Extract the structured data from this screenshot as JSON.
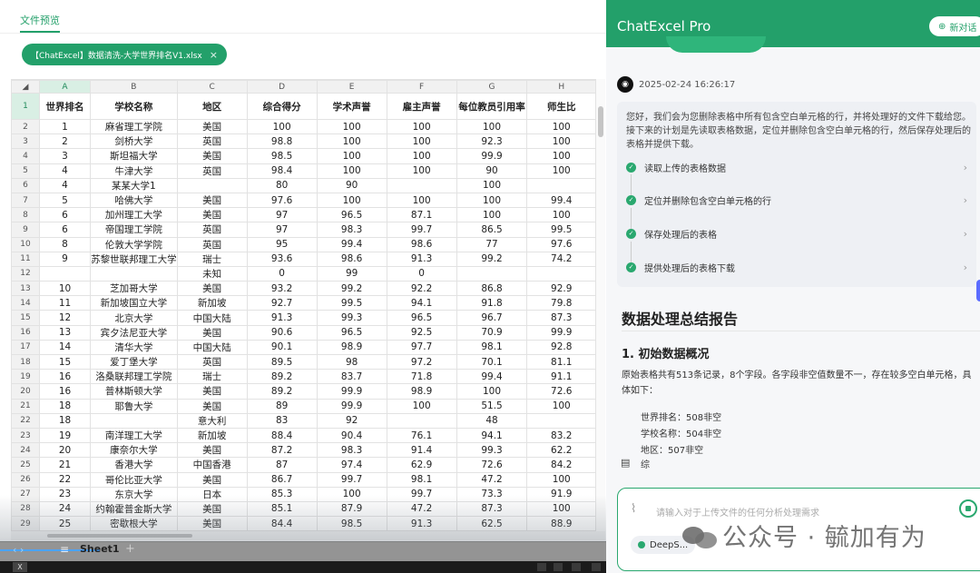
{
  "preview": {
    "tab_label": "文件预览",
    "file_pill": "【ChatExcel】数据清洗-大学世界排名V1.xlsx",
    "file_close": "×"
  },
  "spreadsheet": {
    "column_letters": [
      "A",
      "B",
      "C",
      "D",
      "E",
      "F",
      "G",
      "H"
    ],
    "headers": [
      "世界排名",
      "学校名称",
      "地区",
      "综合得分",
      "学术声誉",
      "雇主声誉",
      "每位教员引用率",
      "师生比"
    ],
    "rows": [
      [
        "2",
        "1",
        "麻省理工学院",
        "美国",
        "100",
        "100",
        "100",
        "100",
        "100"
      ],
      [
        "3",
        "2",
        "剑桥大学",
        "英国",
        "98.8",
        "100",
        "100",
        "92.3",
        "100"
      ],
      [
        "4",
        "3",
        "斯坦福大学",
        "美国",
        "98.5",
        "100",
        "100",
        "99.9",
        "100"
      ],
      [
        "5",
        "4",
        "牛津大学",
        "英国",
        "98.4",
        "100",
        "100",
        "90",
        "100"
      ],
      [
        "6",
        "4",
        "某某大学1",
        "",
        "80",
        "90",
        "",
        "100",
        ""
      ],
      [
        "7",
        "5",
        "哈佛大学",
        "美国",
        "97.6",
        "100",
        "100",
        "100",
        "99.4"
      ],
      [
        "8",
        "6",
        "加州理工大学",
        "美国",
        "97",
        "96.5",
        "87.1",
        "100",
        "100"
      ],
      [
        "9",
        "6",
        "帝国理工学院",
        "英国",
        "97",
        "98.3",
        "99.7",
        "86.5",
        "99.5"
      ],
      [
        "10",
        "8",
        "伦敦大学学院",
        "英国",
        "95",
        "99.4",
        "98.6",
        "77",
        "97.6"
      ],
      [
        "11",
        "9",
        "苏黎世联邦理工大学",
        "瑞士",
        "93.6",
        "98.6",
        "91.3",
        "99.2",
        "74.2"
      ],
      [
        "12",
        "",
        "",
        "未知",
        "0",
        "99",
        "0",
        "",
        ""
      ],
      [
        "13",
        "10",
        "芝加哥大学",
        "美国",
        "93.2",
        "99.2",
        "92.2",
        "86.8",
        "92.9"
      ],
      [
        "14",
        "11",
        "新加坡国立大学",
        "新加坡",
        "92.7",
        "99.5",
        "94.1",
        "91.8",
        "79.8"
      ],
      [
        "15",
        "12",
        "北京大学",
        "中国大陆",
        "91.3",
        "99.3",
        "96.5",
        "96.7",
        "87.3"
      ],
      [
        "16",
        "13",
        "宾夕法尼亚大学",
        "美国",
        "90.6",
        "96.5",
        "92.5",
        "70.9",
        "99.9"
      ],
      [
        "17",
        "14",
        "清华大学",
        "中国大陆",
        "90.1",
        "98.9",
        "97.7",
        "98.1",
        "92.8"
      ],
      [
        "18",
        "15",
        "爱丁堡大学",
        "英国",
        "89.5",
        "98",
        "97.2",
        "70.1",
        "81.1"
      ],
      [
        "19",
        "16",
        "洛桑联邦理工学院",
        "瑞士",
        "89.2",
        "83.7",
        "71.8",
        "99.4",
        "91.1"
      ],
      [
        "20",
        "16",
        "普林斯顿大学",
        "美国",
        "89.2",
        "99.9",
        "98.9",
        "100",
        "72.6"
      ],
      [
        "21",
        "18",
        "耶鲁大学",
        "美国",
        "89",
        "99.9",
        "100",
        "51.5",
        "100"
      ],
      [
        "22",
        "18",
        "",
        "意大利",
        "83",
        "92",
        "",
        "48",
        ""
      ],
      [
        "23",
        "19",
        "南洋理工大学",
        "新加坡",
        "88.4",
        "90.4",
        "76.1",
        "94.1",
        "83.2"
      ],
      [
        "24",
        "20",
        "康奈尔大学",
        "美国",
        "87.2",
        "98.3",
        "91.4",
        "99.3",
        "62.2"
      ],
      [
        "25",
        "21",
        "香港大学",
        "中国香港",
        "87",
        "97.4",
        "62.9",
        "72.6",
        "84.2"
      ],
      [
        "26",
        "22",
        "哥伦比亚大学",
        "美国",
        "86.7",
        "99.7",
        "98.1",
        "47.2",
        "100"
      ],
      [
        "27",
        "23",
        "东京大学",
        "日本",
        "85.3",
        "100",
        "99.7",
        "73.3",
        "91.9"
      ],
      [
        "28",
        "24",
        "约翰霍普金斯大学",
        "美国",
        "85.1",
        "87.9",
        "47.2",
        "87.3",
        "100"
      ],
      [
        "29",
        "25",
        "密歇根大学",
        "美国",
        "84.4",
        "98.5",
        "91.3",
        "62.5",
        "88.9"
      ]
    ],
    "sheet_tab": "Sheet1",
    "add_sheet": "+",
    "sheet_menu": "≡",
    "sheet_nav": "‹ ›",
    "app_icon_label": "X"
  },
  "assistant": {
    "title": "ChatExcel Pro",
    "new_chat": "新对话",
    "timestamp": "2025-02-24 16:26:17",
    "intro": "您好，我们会为您删除表格中所有包含空白单元格的行，并将处理好的文件下载给您。接下来的计划是先读取表格数据，定位并删除包含空白单元格的行，然后保存处理后的表格并提供下载。",
    "steps": [
      "读取上传的表格数据",
      "定位并删除包含空白单元格的行",
      "保存处理后的表格",
      "提供处理后的表格下载"
    ],
    "report_title": "数据处理总结报告",
    "section1_title": "1. 初始数据概况",
    "section1_text": "原始表格共有513条记录，8个字段。各字段非空值数量不一，存在较多空白单元格，具体如下：",
    "stats": [
      "世界排名：508非空",
      "学校名称：504非空",
      "地区：507非空"
    ],
    "truncated_word": "综",
    "input_placeholder": "请输入对于上传文件的任何分析处理需求",
    "model_label": "DeepS..."
  },
  "watermark": "公众号 · 毓加有为",
  "colors": {
    "accent": "#23a06a",
    "accent_light": "#d9efe4"
  }
}
